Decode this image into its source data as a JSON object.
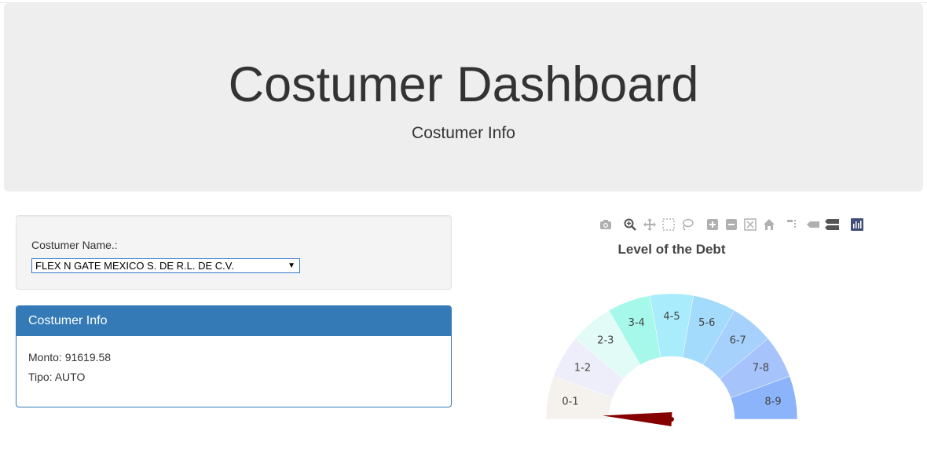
{
  "header": {
    "title": "Costumer Dashboard",
    "subtitle": "Costumer Info"
  },
  "selector": {
    "label": "Costumer Name.:",
    "selected": "FLEX N GATE MEXICO S. DE R.L. DE C.V."
  },
  "info_panel": {
    "heading": "Costumer Info",
    "monto": "Monto: 91619.58",
    "tipo": "Tipo: AUTO"
  },
  "modebar": {
    "icons": [
      "camera-icon",
      "zoom-icon",
      "pan-icon",
      "box-select-icon",
      "lasso-icon",
      "zoom-in-icon",
      "zoom-out-icon",
      "autoscale-icon",
      "reset-axes-icon",
      "spike-lines-icon",
      "hover-closest-icon",
      "hover-compare-icon",
      "plotly-logo-icon"
    ]
  },
  "chart_data": {
    "type": "gauge",
    "title": "Level of the Debt",
    "segments": [
      {
        "label": "0-1",
        "color": "#f5f1ec"
      },
      {
        "label": "1-2",
        "color": "#eeeefa"
      },
      {
        "label": "2-3",
        "color": "#e2fbf6"
      },
      {
        "label": "3-4",
        "color": "#a6f9ea"
      },
      {
        "label": "4-5",
        "color": "#a9ecfb"
      },
      {
        "label": "5-6",
        "color": "#a2dbfb"
      },
      {
        "label": "6-7",
        "color": "#a5d1fc"
      },
      {
        "label": "7-8",
        "color": "#a6c4fb"
      },
      {
        "label": "8-9",
        "color": "#8cb4fa"
      }
    ],
    "range": [
      0,
      9
    ],
    "needle_value": 0.15,
    "needle_color": "#850000"
  }
}
